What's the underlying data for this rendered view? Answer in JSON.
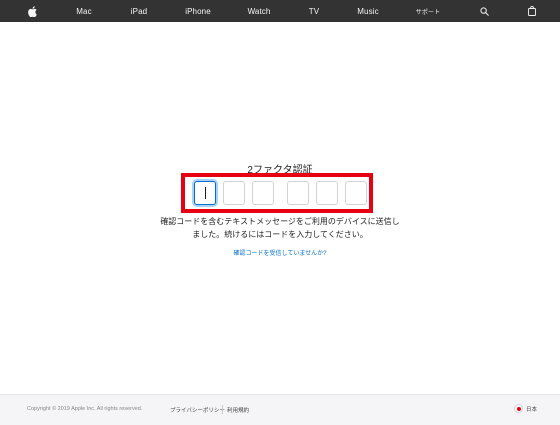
{
  "nav": {
    "items": [
      "Mac",
      "iPad",
      "iPhone",
      "Watch",
      "TV",
      "Music",
      "サポート"
    ],
    "apple_icon": "apple-logo-icon",
    "search_icon": "search-icon",
    "bag_icon": "bag-icon"
  },
  "main": {
    "title": "2ファクタ認証",
    "code_boxes": [
      "",
      "",
      "",
      "",
      "",
      ""
    ],
    "active_box": 0,
    "description": "確認コードを含むテキストメッセージをご利用のデバイスに送信しました。続けるにはコードを入力してください。",
    "link": "確認コードを受信していませんか?"
  },
  "footer": {
    "copyright": "Copyright © 2019 Apple Inc. All rights reserved.",
    "links": [
      "プライバシーポリシー",
      "利用規約"
    ],
    "language": "日本"
  },
  "colors": {
    "nav_bg": "#333333",
    "highlight": "#e60012",
    "link": "#0070c9",
    "focus": "#0070c9"
  }
}
